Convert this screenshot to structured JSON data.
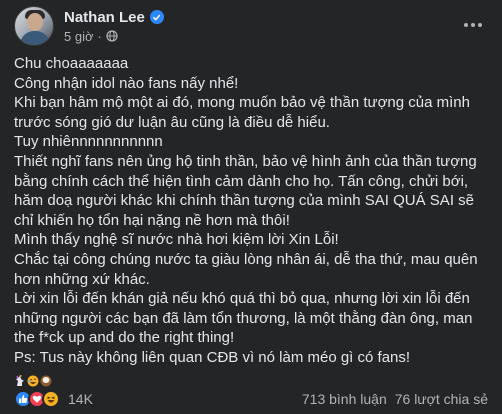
{
  "author": {
    "name": "Nathan Lee",
    "time": "5 giờ",
    "separator": "·"
  },
  "post": {
    "lines": [
      "Chu choaaaaaaa",
      "Công nhận idol nào fans nấy nhể!",
      "Khi bạn hâm mộ một ai đó, mong muốn bảo vệ thần tượng của mình",
      "trước sóng gió dư luận âu cũng là điều dễ hiểu.",
      "Tuy nhiênnnnnnnnnnn",
      "Thiết nghĩ fans nên ủng hộ tinh thần, bảo vệ hình ảnh của thần tượng",
      "bằng chính cách thể hiện tình cảm dành cho họ. Tấn công, chửi bới,",
      "hăm doạ người khác khi chính thần tượng của mình SAI QUÁ SAI sẽ",
      "chỉ khiến họ tổn hại nặng nề hơn mà thôi!",
      "Mình thấy nghệ sĩ nước nhà hơi kiệm lời Xin Lỗi!",
      "Chắc tại công chúng nước ta giàu lòng nhân ái, dễ tha thứ, mau quên",
      "hơn những xứ khác.",
      "Lời xin lỗi đến khán giả nếu khó quá thì bỏ qua, nhưng lời xin lỗi đến",
      "những người các bạn đã làm tổn thương, là một thằng đàn ông, man",
      "the f*ck up and do the right thing!",
      "Ps: Tus này không liên quan CĐB vì nó làm méo gì có fans!"
    ],
    "emojis": [
      "unicorn-emoji",
      "rofl-emoji",
      "coconut-emoji"
    ]
  },
  "footer": {
    "reaction_icons": [
      "like-icon",
      "love-icon",
      "haha-icon"
    ],
    "reaction_count": "14K",
    "comments": "713 bình luận",
    "shares": "76 lượt chia sẻ"
  },
  "colors": {
    "background": "#242526",
    "text": "#e4e6eb",
    "secondary_text": "#b0b3b8",
    "verified": "#2d88ff",
    "like": "#2d88ff",
    "love": "#f33e58",
    "haha": "#f7b125"
  }
}
